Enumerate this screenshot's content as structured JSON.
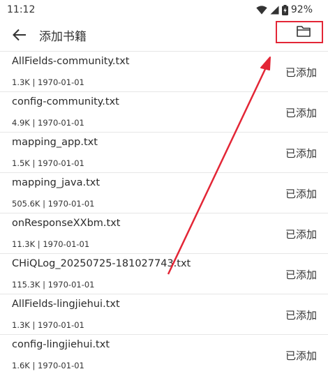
{
  "status_bar": {
    "time": "11:12",
    "battery": "92%",
    "icons": [
      "wifi-icon",
      "cell-signal-icon",
      "battery-charging-icon"
    ]
  },
  "app_bar": {
    "title": "添加书籍",
    "back_icon": "arrow-left-icon",
    "folder_icon": "folder-icon"
  },
  "files": [
    {
      "name": "AllFields-community.txt",
      "meta": "1.3K | 1970-01-01",
      "status": "已添加"
    },
    {
      "name": "config-community.txt",
      "meta": "4.9K | 1970-01-01",
      "status": "已添加"
    },
    {
      "name": "mapping_app.txt",
      "meta": "1.5K | 1970-01-01",
      "status": "已添加"
    },
    {
      "name": "mapping_java.txt",
      "meta": "505.6K | 1970-01-01",
      "status": "已添加"
    },
    {
      "name": "onResponseXXbm.txt",
      "meta": "11.3K | 1970-01-01",
      "status": "已添加"
    },
    {
      "name": "CHiQLog_20250725-181027743.txt",
      "meta": "115.3K | 1970-01-01",
      "status": "已添加"
    },
    {
      "name": "AllFields-lingjiehui.txt",
      "meta": "1.3K | 1970-01-01",
      "status": "已添加"
    },
    {
      "name": "config-lingjiehui.txt",
      "meta": "1.6K | 1970-01-01",
      "status": "已添加"
    }
  ],
  "colors": {
    "annotation": "#e32636",
    "divider": "#e6e6e6"
  }
}
